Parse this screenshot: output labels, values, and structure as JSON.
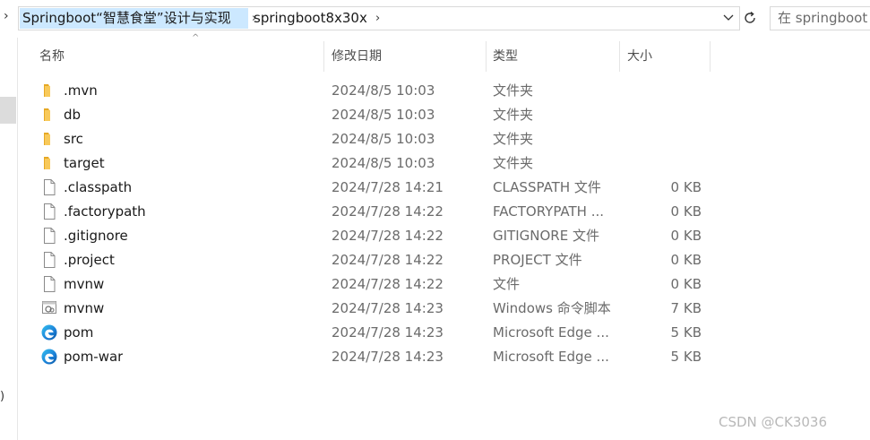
{
  "address": {
    "crumbs": [
      "Springboot“智慧食堂”设计与实现",
      "springboot8x30x"
    ]
  },
  "search": {
    "placeholder": "在 springboot"
  },
  "columns": {
    "name": "名称",
    "modified": "修改日期",
    "type": "类型",
    "size": "大小"
  },
  "files": [
    {
      "name": ".mvn",
      "date": "2024/8/5 10:03",
      "type": "文件夹",
      "size": "",
      "icon": "folder-icon"
    },
    {
      "name": "db",
      "date": "2024/8/5 10:03",
      "type": "文件夹",
      "size": "",
      "icon": "folder-icon"
    },
    {
      "name": "src",
      "date": "2024/8/5 10:03",
      "type": "文件夹",
      "size": "",
      "icon": "folder-icon"
    },
    {
      "name": "target",
      "date": "2024/8/5 10:03",
      "type": "文件夹",
      "size": "",
      "icon": "folder-icon"
    },
    {
      "name": ".classpath",
      "date": "2024/7/28 14:21",
      "type": "CLASSPATH 文件",
      "size": "0 KB",
      "icon": "file-icon"
    },
    {
      "name": ".factorypath",
      "date": "2024/7/28 14:22",
      "type": "FACTORYPATH ...",
      "size": "0 KB",
      "icon": "file-icon"
    },
    {
      "name": ".gitignore",
      "date": "2024/7/28 14:22",
      "type": "GITIGNORE 文件",
      "size": "0 KB",
      "icon": "file-icon"
    },
    {
      "name": ".project",
      "date": "2024/7/28 14:22",
      "type": "PROJECT 文件",
      "size": "0 KB",
      "icon": "file-icon"
    },
    {
      "name": "mvnw",
      "date": "2024/7/28 14:22",
      "type": "文件",
      "size": "0 KB",
      "icon": "file-icon"
    },
    {
      "name": "mvnw",
      "date": "2024/7/28 14:23",
      "type": "Windows 命令脚本",
      "size": "7 KB",
      "icon": "script-icon"
    },
    {
      "name": "pom",
      "date": "2024/7/28 14:23",
      "type": "Microsoft Edge ...",
      "size": "5 KB",
      "icon": "edge-icon"
    },
    {
      "name": "pom-war",
      "date": "2024/7/28 14:23",
      "type": "Microsoft Edge ...",
      "size": "5 KB",
      "icon": "edge-icon"
    }
  ],
  "watermark": "CSDN @CK3036",
  "colors": {
    "selection": "#cce8ff",
    "folder": "#f8c95a"
  }
}
